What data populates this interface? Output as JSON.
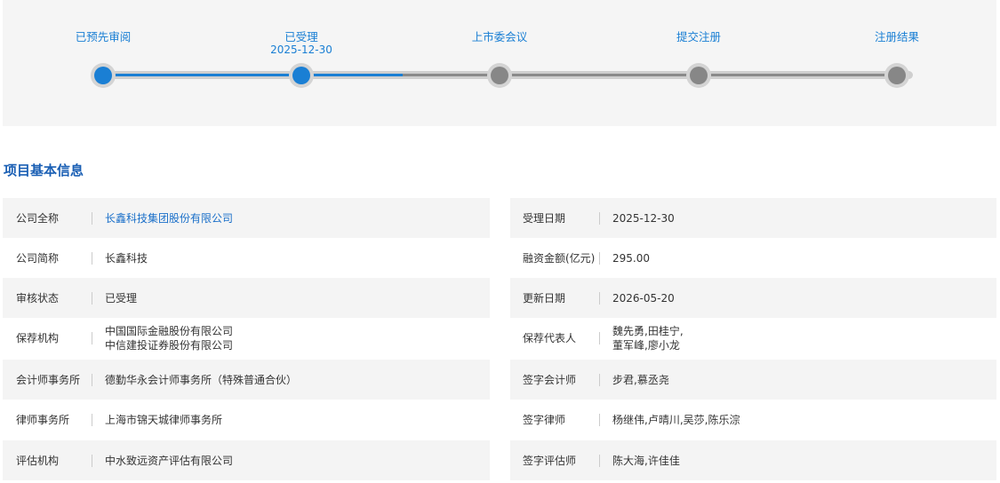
{
  "progress": {
    "steps": [
      {
        "label": "已预先审阅",
        "date": "",
        "status": "done"
      },
      {
        "label": "已受理",
        "date": "2025-12-30",
        "status": "done"
      },
      {
        "label": "上市委会议",
        "date": "",
        "status": "todo"
      },
      {
        "label": "提交注册",
        "date": "",
        "status": "todo"
      },
      {
        "label": "注册结果",
        "date": "",
        "status": "todo"
      }
    ],
    "colors": {
      "active": "#1a7fd4",
      "inactive": "#878787"
    }
  },
  "section": {
    "title": "项目基本信息"
  },
  "info": {
    "left": [
      {
        "label": "公司全称",
        "value": "长鑫科技集团股份有限公司",
        "value2": ""
      },
      {
        "label": "公司简称",
        "value": "长鑫科技",
        "value2": ""
      },
      {
        "label": "审核状态",
        "value": "已受理",
        "value2": ""
      },
      {
        "label": "保荐机构",
        "value": "中国国际金融股份有限公司",
        "value2": "中信建投证券股份有限公司"
      },
      {
        "label": "会计师事务所",
        "value": "德勤华永会计师事务所（特殊普通合伙）",
        "value2": ""
      },
      {
        "label": "律师事务所",
        "value": "上海市锦天城律师事务所",
        "value2": ""
      },
      {
        "label": "评估机构",
        "value": "中水致远资产评估有限公司",
        "value2": ""
      }
    ],
    "right": [
      {
        "label": "受理日期",
        "value": "2025-12-30",
        "value2": ""
      },
      {
        "label": "融资金额(亿元)",
        "value": "295.00",
        "value2": ""
      },
      {
        "label": "更新日期",
        "value": "2026-05-20",
        "value2": ""
      },
      {
        "label": "保荐代表人",
        "value": "魏先勇,田桂宁,",
        "value2": "董军峰,廖小龙"
      },
      {
        "label": "签字会计师",
        "value": "步君,慕丞尧",
        "value2": ""
      },
      {
        "label": "签字律师",
        "value": "杨继伟,卢晴川,吴莎,陈乐淙",
        "value2": ""
      },
      {
        "label": "签字评估师",
        "value": "陈大海,许佳佳",
        "value2": ""
      }
    ]
  }
}
